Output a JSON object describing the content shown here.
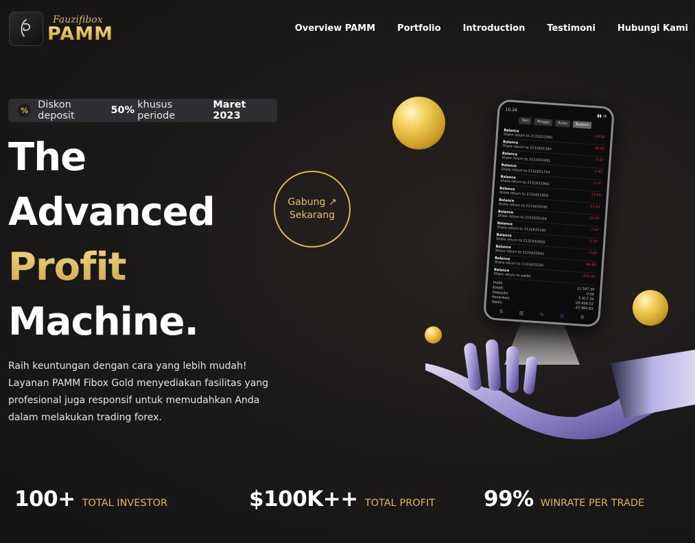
{
  "brand": {
    "script": "Fauzifibox",
    "name": "PAMM"
  },
  "nav": {
    "items": [
      {
        "label": "Overview PAMM"
      },
      {
        "label": "Portfolio"
      },
      {
        "label": "Introduction"
      },
      {
        "label": "Testimoni"
      },
      {
        "label": "Hubungi Kami"
      }
    ]
  },
  "promo": {
    "icon": "percent-icon",
    "prefix": "Diskon deposit",
    "highlight": "50%",
    "middle": "khusus periode",
    "period": "Maret 2023"
  },
  "hero": {
    "line1": "The",
    "line2": "Advanced",
    "line3": "Profit",
    "line4": "Machine.",
    "description": "Raih keuntungan dengan cara yang lebih mudah! Layanan PAMM Fibox Gold menyediakan fasilitas yang profesional juga responsif untuk memudahkan Anda dalam melakukan trading forex."
  },
  "cta": {
    "line1": "Gabung ↗",
    "line2": "Sekarang"
  },
  "stats": [
    {
      "value": "100+",
      "label": "TOTAL INVESTOR"
    },
    {
      "value": "$100K++",
      "label": "TOTAL PROFIT"
    },
    {
      "value": "99%",
      "label": "WINRATE PER TRADE"
    }
  ],
  "phone": {
    "time": "10.24",
    "tabs": [
      "Hari",
      "Minggu",
      "Bulan",
      "Kustom"
    ],
    "rows": [
      {
        "title": "Balance",
        "sub": "Share return to 2131631560",
        "amount": "-74.84"
      },
      {
        "title": "Balance",
        "sub": "Share return to 2131631584",
        "amount": "-16.00"
      },
      {
        "title": "Balance",
        "sub": "Share return to 2131631661",
        "amount": "-7.47"
      },
      {
        "title": "Balance",
        "sub": "Share return to 2131631724",
        "amount": "-7.47"
      },
      {
        "title": "Balance",
        "sub": "Share return to 2131631963",
        "amount": "-7.47"
      },
      {
        "title": "Balance",
        "sub": "Share return to 2131631909",
        "amount": "-13.60"
      },
      {
        "title": "Balance",
        "sub": "Share return to 2131633546",
        "amount": "-13.31"
      },
      {
        "title": "Balance",
        "sub": "Share return to 2131632109",
        "amount": "-14.60"
      },
      {
        "title": "Balance",
        "sub": "Share return to 2131632180",
        "amount": "-7.47"
      },
      {
        "title": "Balance",
        "sub": "Share return to 2131632600",
        "amount": "-7.47"
      },
      {
        "title": "Balance",
        "sub": "Share return to 2131632662",
        "amount": "-7.47"
      },
      {
        "title": "Balance",
        "sub": "Share return to 2131633100",
        "amount": "-26.80"
      },
      {
        "title": "Balance",
        "sub": "Share return to wallet",
        "amount": "-521.61"
      }
    ],
    "summary": [
      {
        "k": "Profit:",
        "v": "11 547.35"
      },
      {
        "k": "Kredit:",
        "v": "0.00"
      },
      {
        "k": "Deposito:",
        "v": "5 917.34"
      },
      {
        "k": "Penarikan:",
        "v": "-28 426.52"
      },
      {
        "k": "Saldo:",
        "v": "-10 964.83"
      }
    ]
  }
}
